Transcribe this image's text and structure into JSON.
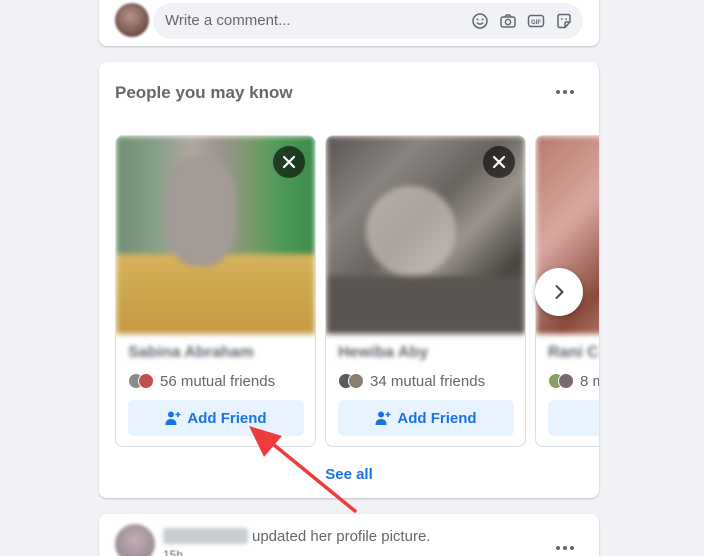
{
  "comment": {
    "placeholder": "Write a comment...",
    "icons": [
      "emoji-icon",
      "camera-icon",
      "gif-icon",
      "sticker-icon"
    ]
  },
  "pymk": {
    "title": "People you may know",
    "people": [
      {
        "name": "Sabina Abraham",
        "mutual": "56 mutual friends",
        "add_label": "Add Friend"
      },
      {
        "name": "Hewiba Aby",
        "mutual": "34 mutual friends",
        "add_label": "Add Friend"
      },
      {
        "name": "Rani C",
        "mutual": "8 m",
        "add_label": ""
      }
    ],
    "see_all": "See all"
  },
  "post": {
    "action": "updated her profile picture.",
    "time": "15h"
  },
  "colors": {
    "accent": "#1b74e4",
    "button_bg": "#e7f3ff",
    "annotation_arrow": "#ee3b3b"
  }
}
